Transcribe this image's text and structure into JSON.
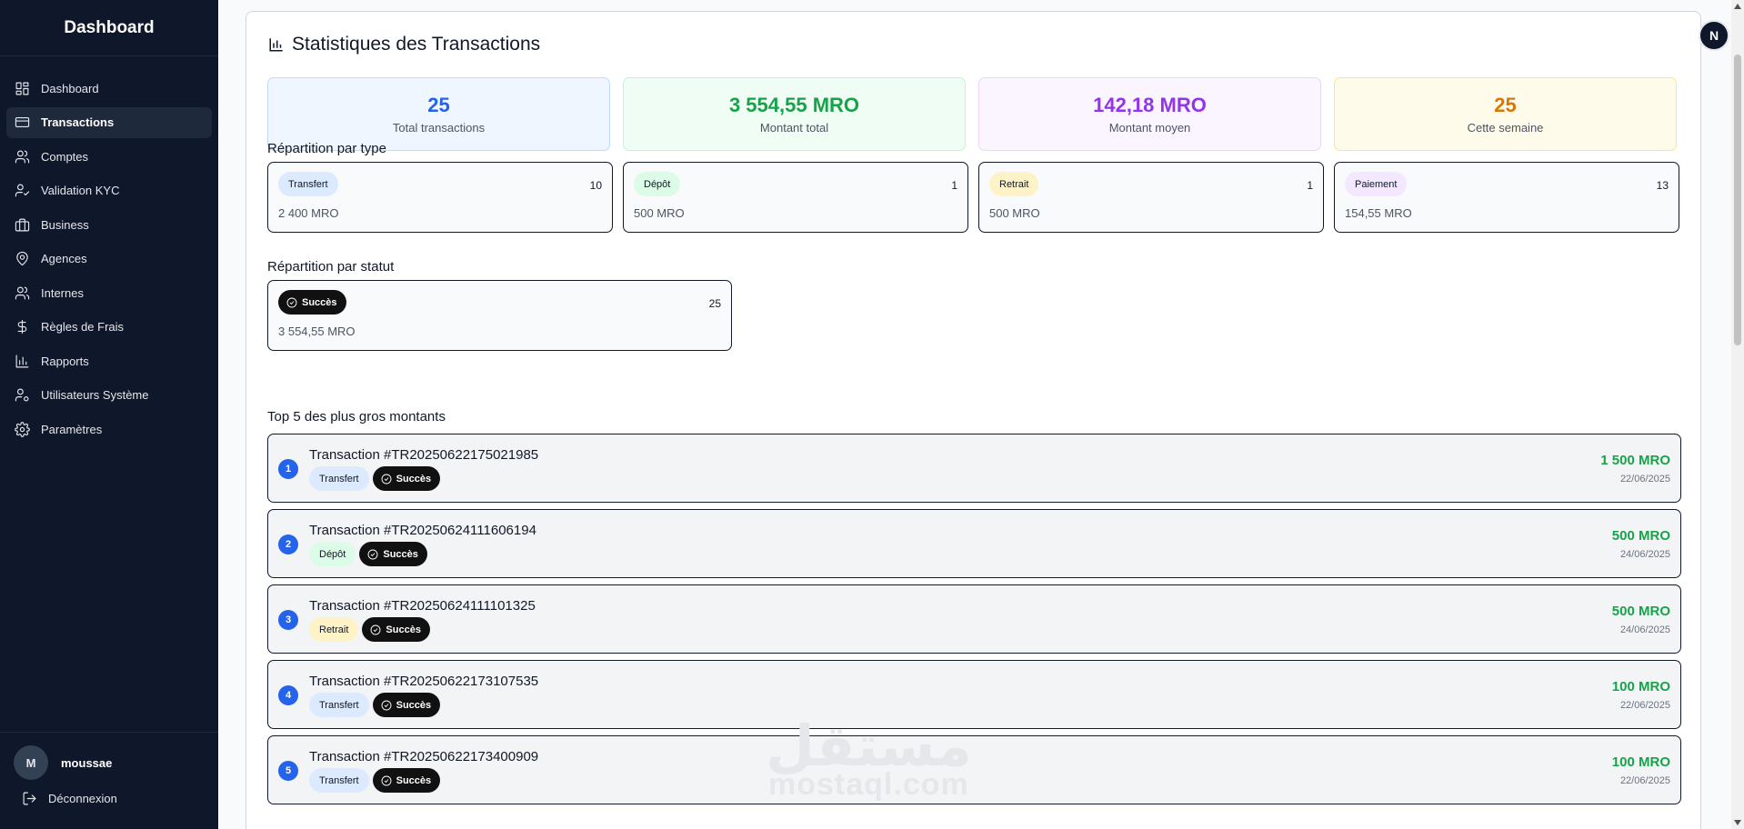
{
  "sidebar": {
    "brand": "Dashboard",
    "items": [
      {
        "label": "Dashboard",
        "icon": "dashboard-icon"
      },
      {
        "label": "Transactions",
        "icon": "credit-card-icon",
        "active": true
      },
      {
        "label": "Comptes",
        "icon": "users-icon"
      },
      {
        "label": "Validation KYC",
        "icon": "user-check-icon"
      },
      {
        "label": "Business",
        "icon": "briefcase-icon"
      },
      {
        "label": "Agences",
        "icon": "map-pin-icon"
      },
      {
        "label": "Internes",
        "icon": "users-icon"
      },
      {
        "label": "Règles de Frais",
        "icon": "dollar-icon"
      },
      {
        "label": "Rapports",
        "icon": "bar-chart-icon"
      },
      {
        "label": "Utilisateurs Système",
        "icon": "user-cog-icon"
      },
      {
        "label": "Paramètres",
        "icon": "gear-icon"
      }
    ],
    "user": {
      "initial": "M",
      "name": "moussae"
    },
    "logout_label": "Déconnexion"
  },
  "header": {
    "avatar_initial": "N"
  },
  "main": {
    "title": "Statistiques des Transactions",
    "stats": [
      {
        "value": "25",
        "label": "Total transactions"
      },
      {
        "value": "3 554,55 MRO",
        "label": "Montant total"
      },
      {
        "value": "142,18 MRO",
        "label": "Montant moyen"
      },
      {
        "value": "25",
        "label": "Cette semaine"
      }
    ],
    "by_type_label": "Répartition par type",
    "by_type": [
      {
        "type": "Transfert",
        "count": "10",
        "amount": "2 400 MRO"
      },
      {
        "type": "Dépôt",
        "count": "1",
        "amount": "500 MRO"
      },
      {
        "type": "Retrait",
        "count": "1",
        "amount": "500 MRO"
      },
      {
        "type": "Paiement",
        "count": "13",
        "amount": "154,55 MRO"
      }
    ],
    "by_status_label": "Répartition par statut",
    "by_status": {
      "status": "Succès",
      "count": "25",
      "amount": "3 554,55 MRO"
    },
    "top_label": "Top 5 des plus gros montants",
    "top": [
      {
        "rank": "1",
        "name": "Transaction #TR20250622175021985",
        "type": "Transfert",
        "status": "Succès",
        "amount": "1 500 MRO",
        "date": "22/06/2025"
      },
      {
        "rank": "2",
        "name": "Transaction #TR20250624111606194",
        "type": "Dépôt",
        "status": "Succès",
        "amount": "500 MRO",
        "date": "24/06/2025"
      },
      {
        "rank": "3",
        "name": "Transaction #TR20250624111101325",
        "type": "Retrait",
        "status": "Succès",
        "amount": "500 MRO",
        "date": "24/06/2025"
      },
      {
        "rank": "4",
        "name": "Transaction #TR20250622173107535",
        "type": "Transfert",
        "status": "Succès",
        "amount": "100 MRO",
        "date": "22/06/2025"
      },
      {
        "rank": "5",
        "name": "Transaction #TR20250622173400909",
        "type": "Transfert",
        "status": "Succès",
        "amount": "100 MRO",
        "date": "22/06/2025"
      }
    ]
  },
  "watermark": {
    "arabic": "مستقل",
    "latin": "mostaql.com"
  }
}
